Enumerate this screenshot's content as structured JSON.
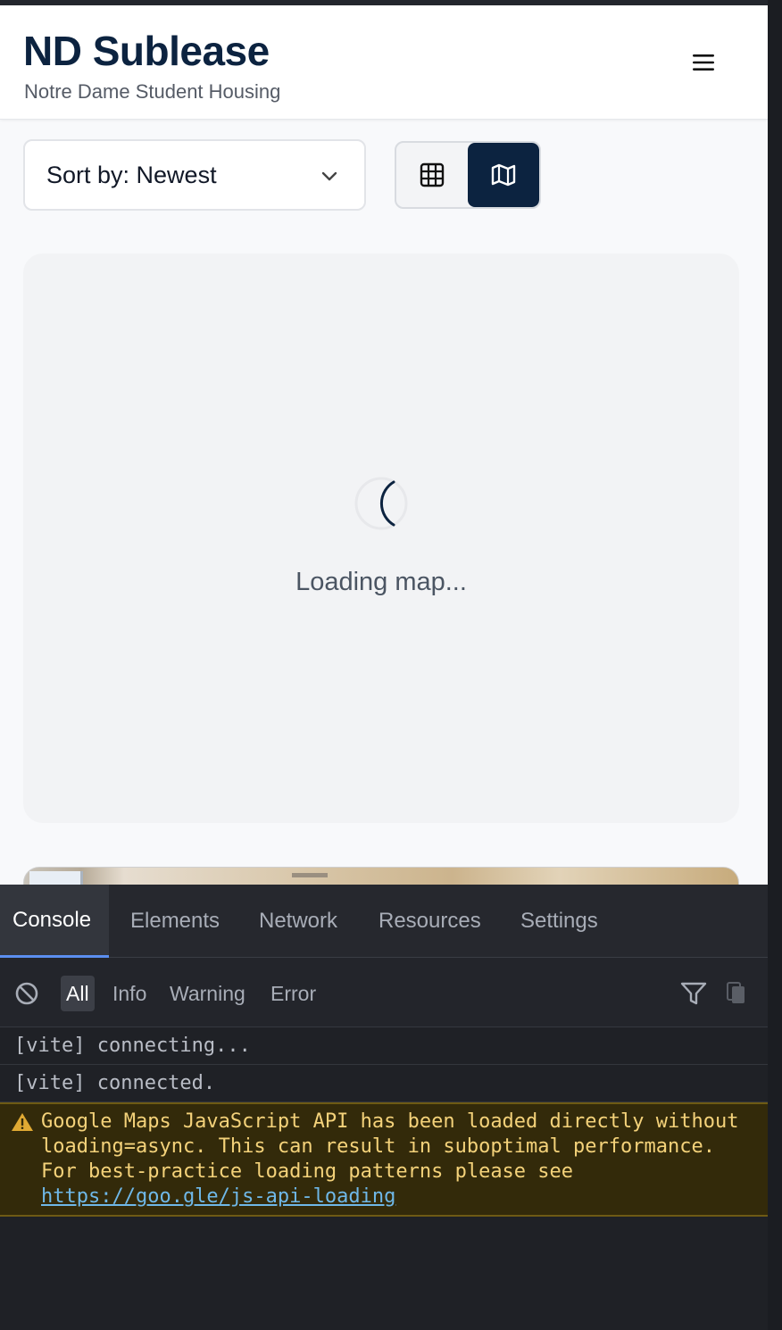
{
  "app": {
    "title": "ND Sublease",
    "subtitle": "Notre Dame Student Housing",
    "menu_icon": "hamburger-menu-icon"
  },
  "toolbar": {
    "sort_label": "Sort by: Newest",
    "view_modes": [
      {
        "name": "grid",
        "icon": "grid-icon",
        "active": false
      },
      {
        "name": "map",
        "icon": "map-icon",
        "active": true
      }
    ],
    "accent_color": "#0c2340"
  },
  "map": {
    "loading_text": "Loading map..."
  },
  "devtools": {
    "tabs": [
      "Console",
      "Elements",
      "Network",
      "Resources",
      "Settings"
    ],
    "active_tab": "Console",
    "filters": [
      "All",
      "Info",
      "Warning",
      "Error"
    ],
    "active_filter": "All",
    "logs": [
      {
        "level": "log",
        "text": "[vite] connecting..."
      },
      {
        "level": "log",
        "text": "[vite] connected."
      }
    ],
    "warning": {
      "text": "Google Maps JavaScript API has been loaded directly without loading=async. This can result in suboptimal performance. For best-practice loading patterns please see",
      "link": "https://goo.gle/js-api-loading"
    }
  }
}
